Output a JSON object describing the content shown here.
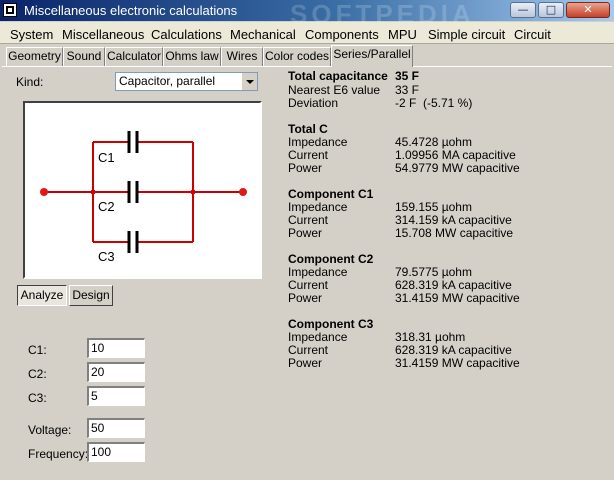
{
  "window": {
    "title": "Miscellaneous electronic calculations",
    "watermark": "SOFTPEDIA",
    "minimize": "—",
    "maximize": "□",
    "close": "✕"
  },
  "menu": [
    "System",
    "Miscellaneous",
    "Calculations",
    "Mechanical",
    "Components",
    "MPU",
    "Simple circuit",
    "Circuit"
  ],
  "tabs": [
    "Geometry",
    "Sound",
    "Calculator",
    "Ohms law",
    "Wires",
    "Color codes",
    "Series/Parallel"
  ],
  "active_tab": "Series/Parallel",
  "kind": {
    "label": "Kind:",
    "value": "Capacitor, parallel"
  },
  "diagram": {
    "labels": [
      "C1",
      "C2",
      "C3"
    ]
  },
  "buttons": {
    "analyze": "Analyze",
    "design": "Design"
  },
  "inputs": [
    {
      "label": "C1:",
      "value": "10"
    },
    {
      "label": "C2:",
      "value": "20"
    },
    {
      "label": "C3:",
      "value": "5"
    },
    {
      "label": "Voltage:",
      "value": "50"
    },
    {
      "label": "Frequency:",
      "value": "100"
    }
  ],
  "results": {
    "total": {
      "label": "Total capacitance",
      "value": "35 F"
    },
    "nearest": {
      "label": "Nearest E6 value",
      "value": "33 F"
    },
    "deviation": {
      "label": "Deviation",
      "value": "-2 F",
      "percent": "(-5.71 %)"
    },
    "groups": [
      {
        "title": "Total C",
        "rows": [
          {
            "label": "Impedance",
            "value": "45.4728 µohm"
          },
          {
            "label": "Current",
            "value": "1.09956 MA capacitive"
          },
          {
            "label": "Power",
            "value": "54.9779 MW capacitive"
          }
        ]
      },
      {
        "title": "Component C1",
        "rows": [
          {
            "label": "Impedance",
            "value": "159.155 µohm"
          },
          {
            "label": "Current",
            "value": "314.159 kA capacitive"
          },
          {
            "label": "Power",
            "value": "15.708 MW capacitive"
          }
        ]
      },
      {
        "title": "Component C2",
        "rows": [
          {
            "label": "Impedance",
            "value": "79.5775 µohm"
          },
          {
            "label": "Current",
            "value": "628.319 kA capacitive"
          },
          {
            "label": "Power",
            "value": "31.4159 MW capacitive"
          }
        ]
      },
      {
        "title": "Component C3",
        "rows": [
          {
            "label": "Impedance",
            "value": "318.31 µohm"
          },
          {
            "label": "Current",
            "value": "628.319 kA capacitive"
          },
          {
            "label": "Power",
            "value": "31.4159 MW capacitive"
          }
        ]
      }
    ]
  },
  "colors": {
    "wire": "#cc0000",
    "terminal": "#e01818"
  }
}
